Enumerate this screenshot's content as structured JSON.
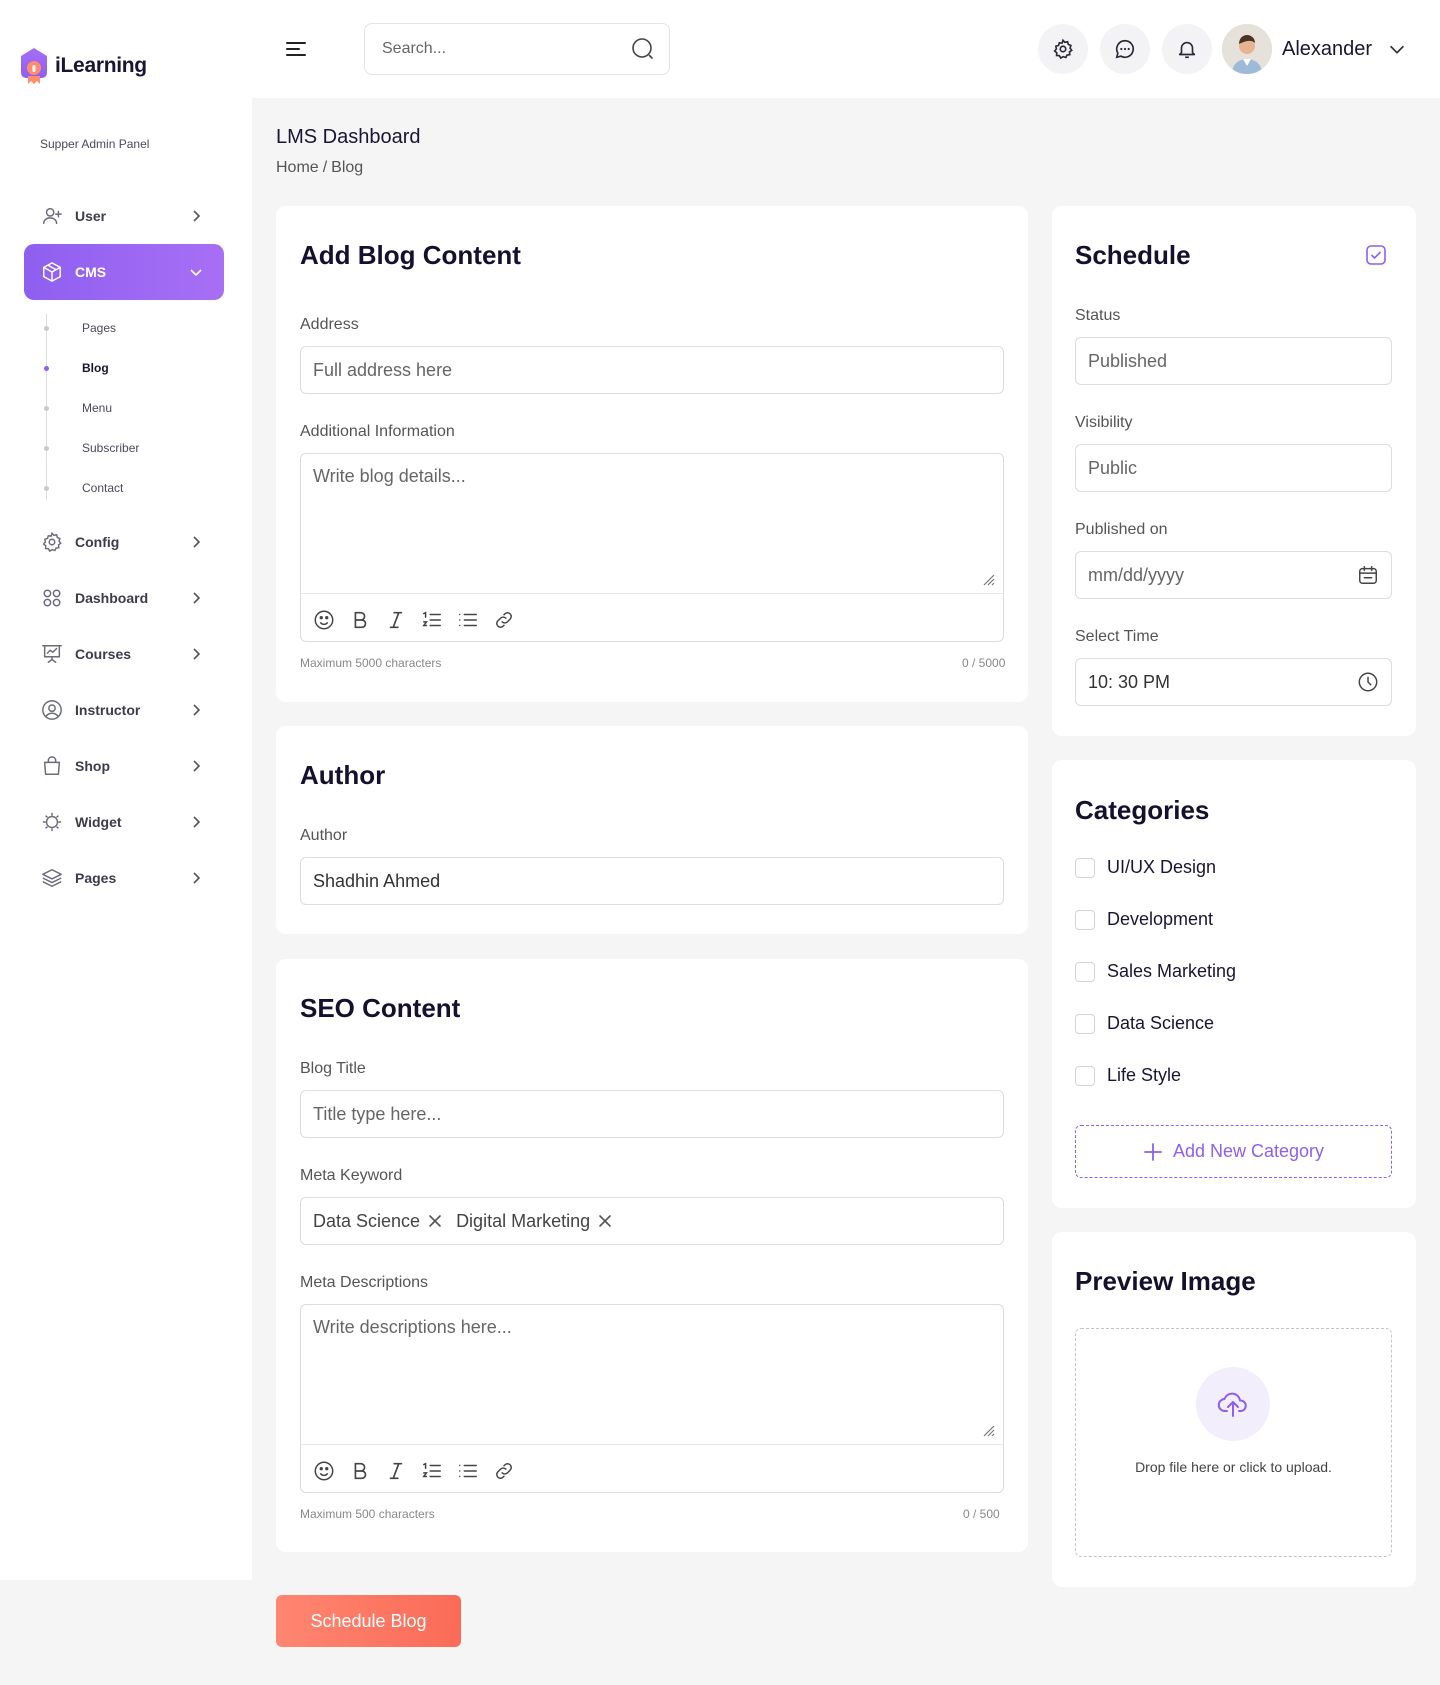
{
  "app": {
    "name": "iLearning",
    "panel_label": "Supper Admin Panel"
  },
  "sidebar": {
    "items": [
      {
        "label": "User",
        "icon": "user-add-icon"
      },
      {
        "label": "CMS",
        "icon": "box-icon",
        "active": true
      },
      {
        "label": "Config",
        "icon": "gear-icon"
      },
      {
        "label": "Dashboard",
        "icon": "grid-icon"
      },
      {
        "label": "Courses",
        "icon": "presentation-icon"
      },
      {
        "label": "Instructor",
        "icon": "user-circle-icon"
      },
      {
        "label": "Shop",
        "icon": "shopping-bag-icon"
      },
      {
        "label": "Widget",
        "icon": "widget-icon"
      },
      {
        "label": "Pages",
        "icon": "layers-icon"
      }
    ],
    "cms_subitems": [
      {
        "label": "Pages"
      },
      {
        "label": "Blog",
        "active": true
      },
      {
        "label": "Menu"
      },
      {
        "label": "Subscriber"
      },
      {
        "label": "Contact"
      }
    ]
  },
  "topbar": {
    "search_placeholder": "Search...",
    "user_name": "Alexander"
  },
  "header": {
    "title": "LMS Dashboard",
    "breadcrumb": [
      "Home",
      "/",
      "Blog"
    ]
  },
  "blog_content": {
    "title": "Add Blog Content",
    "address_label": "Address",
    "address_placeholder": "Full address here",
    "info_label": "Additional Information",
    "info_placeholder": "Write blog details...",
    "max_hint": "Maximum 5000 characters",
    "counter": "0 / 5000"
  },
  "author": {
    "title": "Author",
    "label": "Author",
    "value": "Shadhin Ahmed"
  },
  "seo": {
    "title": "SEO Content",
    "blog_title_label": "Blog Title",
    "blog_title_placeholder": "Title type here...",
    "keyword_label": "Meta Keyword",
    "keywords": [
      "Data Science",
      "Digital Marketing"
    ],
    "desc_label": "Meta Descriptions",
    "desc_placeholder": "Write descriptions here...",
    "max_hint": "Maximum 500 characters",
    "counter": "0 / 500"
  },
  "schedule": {
    "title": "Schedule",
    "status_label": "Status",
    "status_value": "Published",
    "visibility_label": "Visibility",
    "visibility_value": "Public",
    "published_label": "Published on",
    "published_placeholder": "mm/dd/yyyy",
    "time_label": "Select Time",
    "time_value": "10: 30 PM"
  },
  "categories": {
    "title": "Categories",
    "items": [
      "UI/UX Design",
      "Development",
      "Sales Marketing",
      "Data Science",
      "Life Style"
    ],
    "add_label": "Add New Category"
  },
  "preview": {
    "title": "Preview Image",
    "upload_text": "Drop file here or click to upload."
  },
  "actions": {
    "submit_label": "Schedule Blog"
  },
  "colors": {
    "accent": "#8e5ff0",
    "primary_button": "#fa6b57",
    "background": "#f5f5f6"
  }
}
